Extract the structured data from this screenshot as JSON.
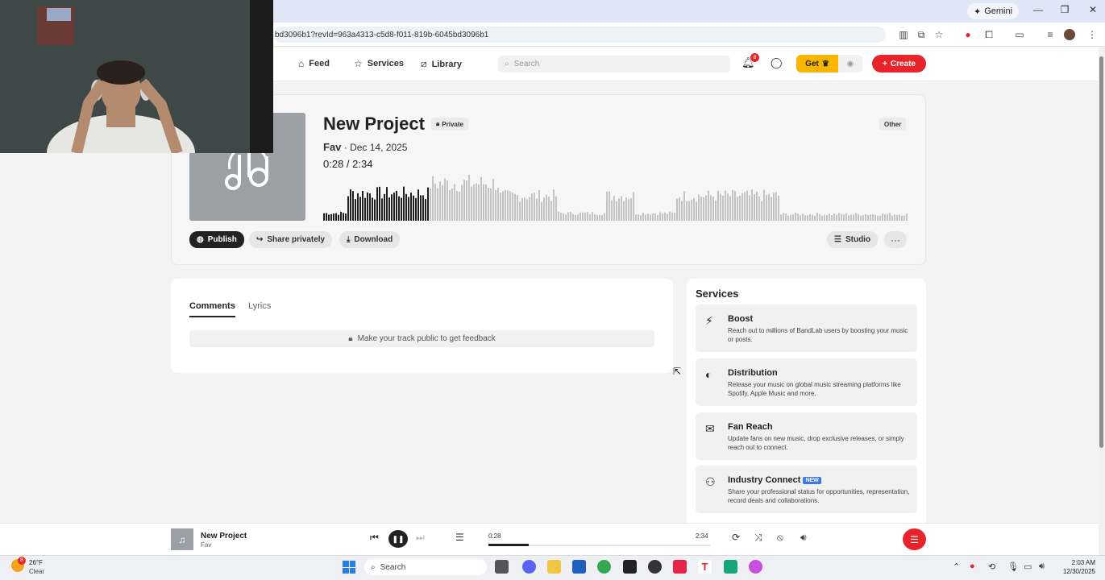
{
  "browser": {
    "gemini_label": "Gemini",
    "url": "bd3096b1?revId=963a4313-c5d8-f011-819b-6045bd3096b1"
  },
  "nav": {
    "feed": "Feed",
    "services": "Services",
    "library": "Library",
    "search_placeholder": "Search",
    "notification_count": "8",
    "get_label": "Get",
    "create_label": "Create"
  },
  "project": {
    "title": "New Project",
    "visibility": "Private",
    "genre": "Other",
    "artist": "Fav",
    "date": "· Dec 14, 2025",
    "time_display": "0:28 /  2:34",
    "played_fraction": 0.18
  },
  "actions": {
    "publish": "Publish",
    "share": "Share privately",
    "download": "Download",
    "studio": "Studio",
    "more": "···"
  },
  "comments": {
    "tab_comments": "Comments",
    "tab_lyrics": "Lyrics",
    "feedback_msg": "Make your track public to get feedback"
  },
  "services": {
    "heading": "Services",
    "items": [
      {
        "name": "Boost",
        "desc": "Reach out to millions of BandLab users by boosting your music or posts.",
        "icon": "bolt-icon"
      },
      {
        "name": "Distribution",
        "desc": "Release your music on global music streaming platforms like Spotify, Apple Music and more.",
        "icon": "distribution-icon"
      },
      {
        "name": "Fan Reach",
        "desc": "Update fans on new music, drop exclusive releases, or simply reach out to connect.",
        "icon": "mail-icon"
      },
      {
        "name": "Industry Connect",
        "tag": "NEW",
        "desc": "Share your professional status for opportunities, representation, record deals and collaborations.",
        "icon": "people-icon"
      }
    ]
  },
  "player": {
    "title": "New Project",
    "artist": "Fav",
    "current_time": "0:28",
    "total_time": "2:34"
  },
  "taskbar": {
    "weather_badge": "8",
    "temperature": "26°F",
    "condition": "Clear",
    "search_label": "Search",
    "time": "2:03 AM",
    "date": "12/30/2025"
  },
  "colors": {
    "accent_red": "#e8232a",
    "get_yellow": "#f7b500",
    "new_blue": "#3a78f2"
  }
}
